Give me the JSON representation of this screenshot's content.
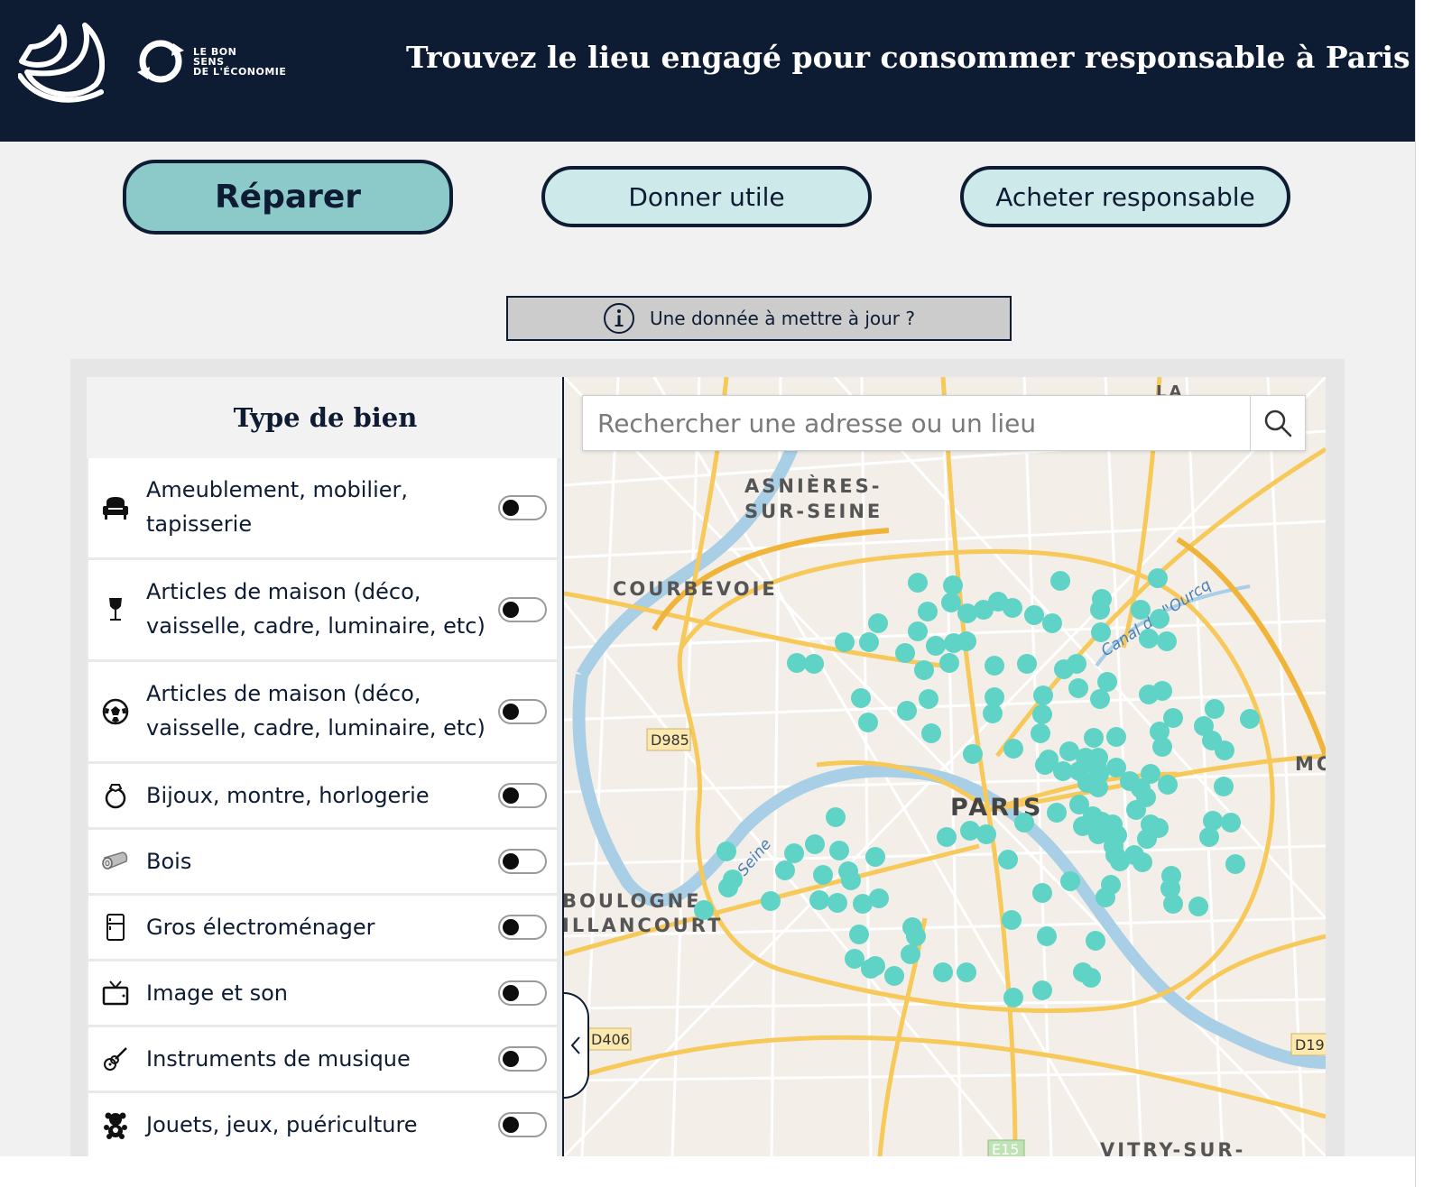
{
  "header": {
    "title": "Trouvez le lieu engagé pour consommer responsable à Paris",
    "logo_bse_lines": [
      "LE BON",
      "SENS",
      "DE L'ÉCONOMIE"
    ]
  },
  "tabs": [
    {
      "label": "Réparer",
      "active": true
    },
    {
      "label": "Donner utile",
      "active": false
    },
    {
      "label": "Acheter responsable",
      "active": false
    }
  ],
  "update_button": {
    "label": "Une donnée à mettre à jour ?"
  },
  "sidebar": {
    "title": "Type de bien",
    "items": [
      {
        "label": "Ameublement, mobilier, tapisserie",
        "icon": "armchair-icon",
        "on": false
      },
      {
        "label": "Articles de maison (déco, vaisselle, cadre, luminaire, etc)",
        "icon": "wine-glass-icon",
        "on": false
      },
      {
        "label": "Articles de maison (déco, vaisselle, cadre, luminaire, etc)",
        "icon": "soccer-ball-icon",
        "on": false
      },
      {
        "label": "Bijoux, montre, horlogerie",
        "icon": "ring-icon",
        "on": false
      },
      {
        "label": "Bois",
        "icon": "wood-log-icon",
        "on": false
      },
      {
        "label": "Gros électroménager",
        "icon": "fridge-icon",
        "on": false
      },
      {
        "label": "Image et son",
        "icon": "tv-icon",
        "on": false
      },
      {
        "label": "Instruments de musique",
        "icon": "guitar-icon",
        "on": false
      },
      {
        "label": "Jouets, jeux, puériculture",
        "icon": "teddy-bear-icon",
        "on": false
      }
    ]
  },
  "map": {
    "search_placeholder": "Rechercher une adresse ou un lieu",
    "marker_color": "#5fd3c6",
    "labels": {
      "asnieres_1": "ASNIÈRES-",
      "asnieres_2": "SUR-SEINE",
      "courbevoie": "COURBEVOIE",
      "paris": "PARIS",
      "boulogne_1": "BOULOGNE",
      "boulogne_2": "ILLANCOURT",
      "mo": "MO",
      "vitry": "VITRY-SUR-",
      "la": "LA",
      "seine": "Seine",
      "canal": "Canal de l'Ourcq",
      "d985": "D985",
      "d406": "D406",
      "d19": "D19",
      "e15": "E15"
    }
  }
}
